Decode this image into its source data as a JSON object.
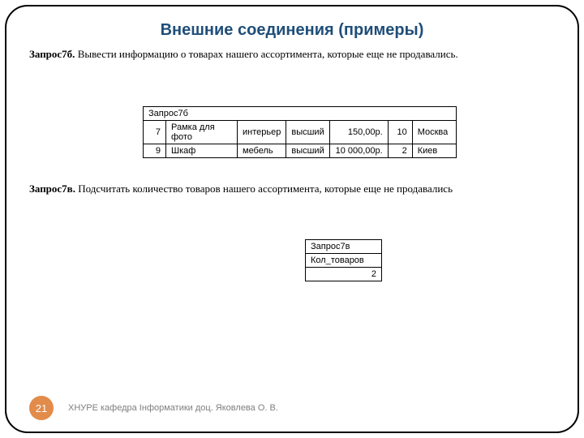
{
  "title": "Внешние соединения (примеры)",
  "p1": {
    "bold": "Запрос7б.",
    "text": " Вывести информацию о товарах нашего ассортимента, которые еще не продавались."
  },
  "table1": {
    "caption": "Запрос7б",
    "rows": [
      {
        "id": "7",
        "name": "Рамка для фото",
        "cat": "интерьер",
        "grade": "высший",
        "price": "150,00р.",
        "qty": "10",
        "city": "Москва"
      },
      {
        "id": "9",
        "name": "Шкаф",
        "cat": "мебель",
        "grade": "высший",
        "price": "10 000,00р.",
        "qty": "2",
        "city": "Киев"
      }
    ]
  },
  "p2": {
    "bold": "Запрос7в. ",
    "text": " Подсчитать количество товаров нашего ассортимента, которые еще не продавались"
  },
  "table2": {
    "caption": "Запрос7в",
    "header": "Кол_товаров",
    "value": "2"
  },
  "footer": {
    "slide_num": "21",
    "text": "ХНУРЕ кафедра Інформатики доц. Яковлева О. В."
  }
}
